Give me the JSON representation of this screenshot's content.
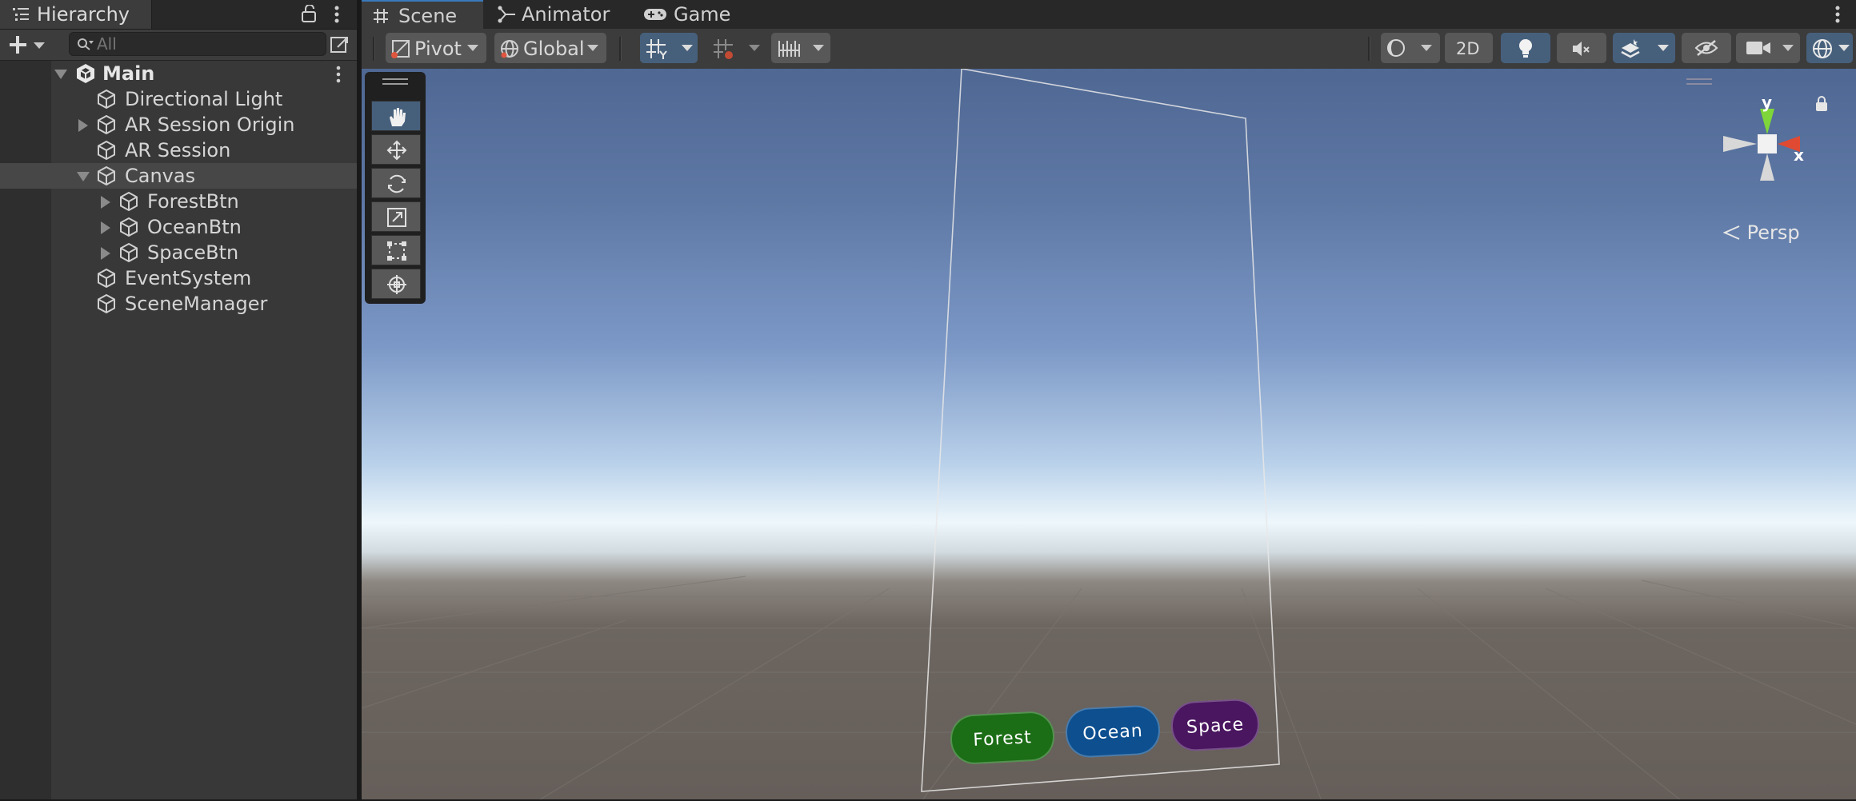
{
  "hierarchy": {
    "tab_label": "Hierarchy",
    "search_placeholder": "All",
    "scene_name": "Main",
    "items": [
      {
        "label": "Directional Light"
      },
      {
        "label": "AR Session Origin"
      },
      {
        "label": "AR Session"
      },
      {
        "label": "Canvas"
      },
      {
        "label": "ForestBtn"
      },
      {
        "label": "OceanBtn"
      },
      {
        "label": "SpaceBtn"
      },
      {
        "label": "EventSystem"
      },
      {
        "label": "SceneManager"
      }
    ]
  },
  "scene_tabs": [
    {
      "label": "Scene",
      "icon": "grid-icon"
    },
    {
      "label": "Animator",
      "icon": "animator-icon"
    },
    {
      "label": "Game",
      "icon": "gamepad-icon"
    }
  ],
  "toolbar": {
    "pivot_label": "Pivot",
    "global_label": "Global",
    "mode_2d_label": "2D"
  },
  "gizmo": {
    "x_label": "x",
    "y_label": "y",
    "projection_label": "Persp"
  },
  "scene_buttons": [
    {
      "label": "Forest",
      "color": "#1b6d16"
    },
    {
      "label": "Ocean",
      "color": "#0d4f8f"
    },
    {
      "label": "Space",
      "color": "#4a1660"
    }
  ],
  "colors": {
    "accent": "#3a79bb",
    "active_tool": "#46607c"
  }
}
